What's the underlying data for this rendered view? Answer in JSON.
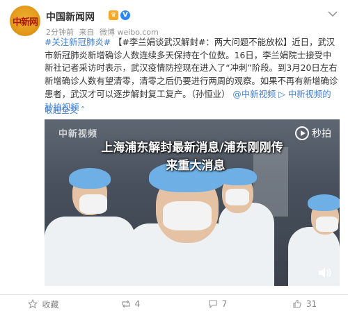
{
  "account": {
    "avatar_text": "中新网",
    "name": "中国新闻网",
    "verified_badge": "V",
    "vip_badge": "♛"
  },
  "meta": {
    "time": "2分钟前",
    "source_prefix": "来自",
    "source": "微博 weibo.com"
  },
  "post": {
    "topic1": "#关注新冠肺炎#",
    "topic2": "【#李兰娟谈武汉解封#：两大问题不能放松】",
    "body1": "近日，武汉市新冠肺炎新增确诊人数连续多天保持在个位数。16日，李兰娟院士接受中新社记者采访时表示，武汉疫情防控现在进入了“冲刺”阶段。到3月20日左右新增确诊人数有望清零，清零之后仍要进行两周的观察。如果不再有新增确诊患者，武汉才可以逐步解封复工复产。（孙恒业）",
    "link1": "@中新视频",
    "link2": "中新视频的秒拍视频",
    "collapse": "收起全文"
  },
  "video": {
    "title_line1": "上海浦东解封最新消息/浦东刚刚传",
    "title_line2": "来重大消息",
    "watermark": "中新视频",
    "brand": "秒拍"
  },
  "actions": {
    "favorite_label": "收藏",
    "repost_count": "4",
    "comment_count": "7",
    "like_count": "31"
  },
  "colors": {
    "link": "#eb7350",
    "blue_link": "#4580d2",
    "meta_gray": "#939393"
  }
}
